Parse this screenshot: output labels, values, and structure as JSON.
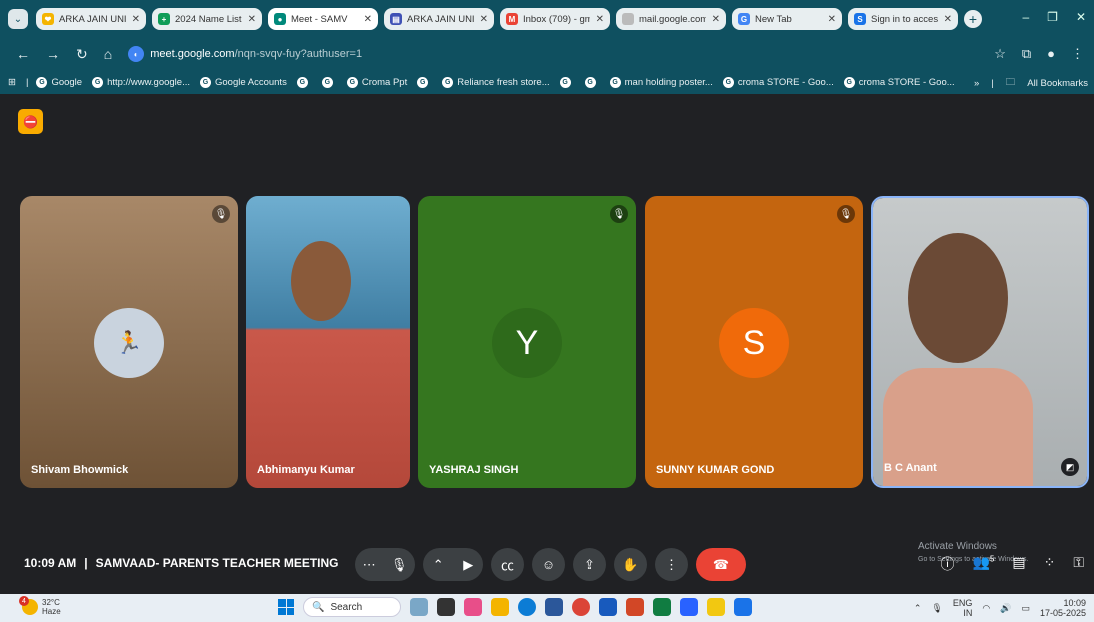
{
  "browser": {
    "tabs": [
      {
        "label": "ARKA JAIN UNIV",
        "fav_color": "#f4b400",
        "fav_text": "❤"
      },
      {
        "label": "2024 Name List",
        "fav_color": "#0f9d58",
        "fav_text": "+"
      },
      {
        "label": "Meet - SAMV",
        "fav_color": "#00897b",
        "fav_text": "●",
        "active": true
      },
      {
        "label": "ARKA JAIN UNIV",
        "fav_color": "#3f51b5",
        "fav_text": "▤"
      },
      {
        "label": "Inbox (709) - gm",
        "fav_color": "#ea4335",
        "fav_text": "M"
      },
      {
        "label": "mail.google.com",
        "fav_color": "#bbbbbb",
        "fav_text": ""
      },
      {
        "label": "New Tab",
        "fav_color": "#4285f4",
        "fav_text": "G"
      },
      {
        "label": "Sign in to access",
        "fav_color": "#1a73e8",
        "fav_text": "S"
      }
    ],
    "url_host": "meet.google.com",
    "url_path": "/nqn-svqv-fuy?authuser=1",
    "bookmarks": [
      "Google",
      "http://www.google...",
      "Google Accounts",
      "",
      "",
      "Croma Ppt",
      "",
      "Reliance fresh store...",
      "",
      "",
      "man holding poster...",
      "croma STORE - Goo...",
      "croma STORE - Goo..."
    ],
    "all_bookmarks": "All Bookmarks"
  },
  "meet": {
    "participants": [
      {
        "name": "Shivam Bhowmick",
        "bg": "#8a6b4b",
        "muted": true
      },
      {
        "name": "Abhimanyu Kumar",
        "bg": "#4b8fb5",
        "muted": false
      },
      {
        "name": "YASHRAJ SINGH",
        "bg": "#3a7a2a",
        "muted": true,
        "initial": "Y"
      },
      {
        "name": "SUNNY KUMAR GOND",
        "bg": "#c4650f",
        "muted": true,
        "initial": "S"
      },
      {
        "name": "B C Anant",
        "bg": "#b0b4b5",
        "muted": false
      }
    ],
    "time": "10:09 AM",
    "separator": "|",
    "meeting_title": "SAMVAAD- PARENTS TEACHER MEETING",
    "participant_count": "5",
    "activate_title": "Activate Windows",
    "activate_sub": "Go to Settings to activate Windows."
  },
  "taskbar": {
    "temp": "32°C",
    "weather": "Haze",
    "weather_badge": "4",
    "search": "Search",
    "lang": "ENG",
    "region": "IN",
    "clock_time": "10:09",
    "clock_date": "17-05-2025"
  }
}
